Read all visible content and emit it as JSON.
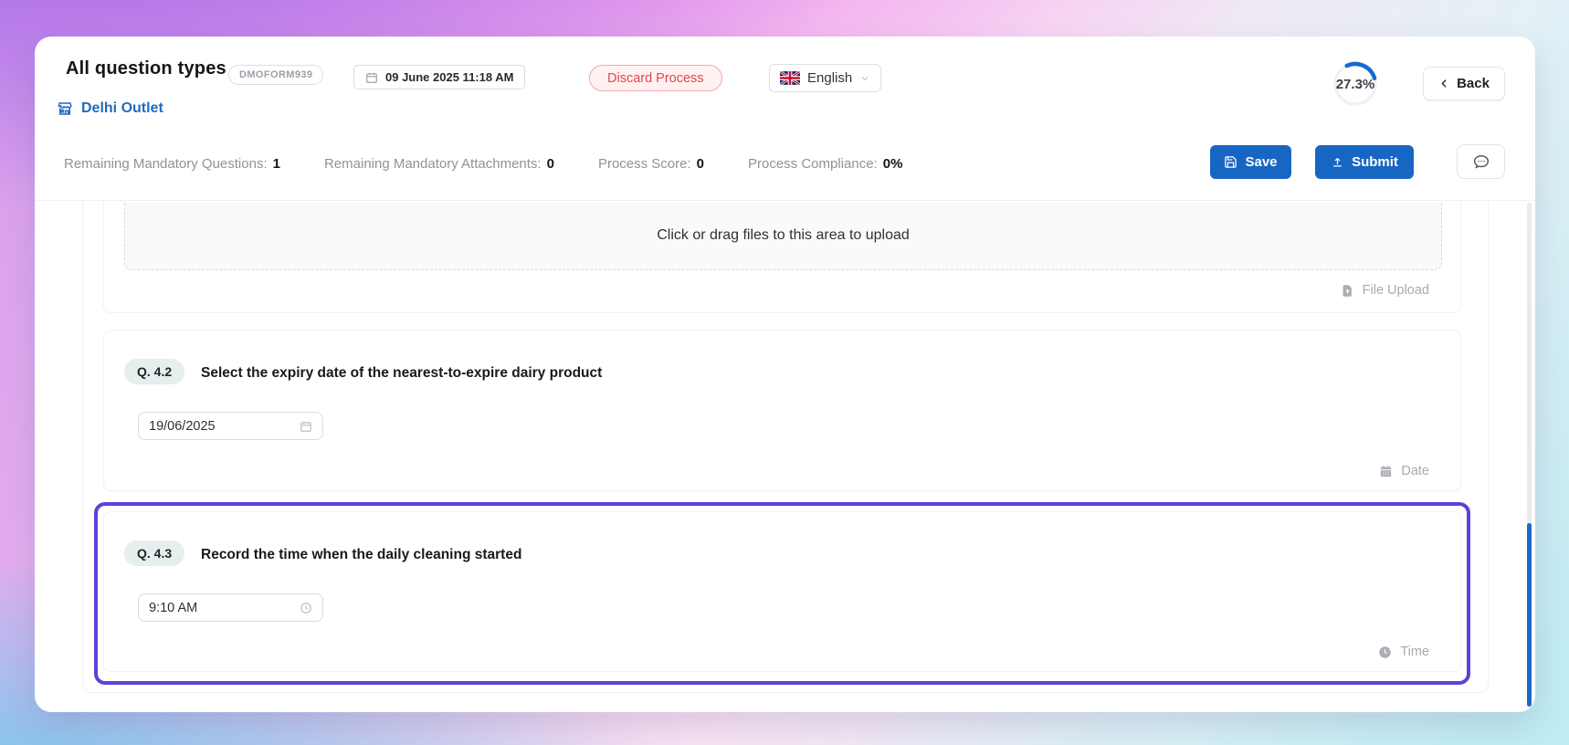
{
  "header": {
    "title": "All question types",
    "form_code": "DMOFORM939",
    "datetime": "09 June 2025 11:18 AM",
    "discard_label": "Discard Process",
    "language": "English",
    "progress": "27.3%",
    "back_label": "Back",
    "outlet": "Delhi Outlet",
    "stats": [
      {
        "label": "Remaining Mandatory Questions:",
        "value": "1"
      },
      {
        "label": "Remaining Mandatory Attachments:",
        "value": "0"
      },
      {
        "label": "Process Score:",
        "value": "0"
      },
      {
        "label": "Process Compliance:",
        "value": "0%"
      }
    ],
    "save_label": "Save",
    "submit_label": "Submit"
  },
  "content": {
    "upload_question": {
      "dropzone_text": "Click or drag files to this area to upload",
      "type_label": "File Upload"
    },
    "questions": [
      {
        "number": "Q. 4.2",
        "text": "Select the expiry date of the nearest-to-expire dairy product",
        "value": "19/06/2025",
        "type_label": "Date",
        "highlighted": false
      },
      {
        "number": "Q. 4.3",
        "text": "Record the time when the daily cleaning started",
        "value": "9:10 AM",
        "type_label": "Time",
        "highlighted": true
      }
    ]
  },
  "colors": {
    "primary_blue": "#1866c4",
    "highlight_purple": "#5a43d8",
    "discard_red": "#e2474d",
    "link_blue": "#1e6cc0",
    "scrollbar_blue": "#1b6ac9"
  }
}
